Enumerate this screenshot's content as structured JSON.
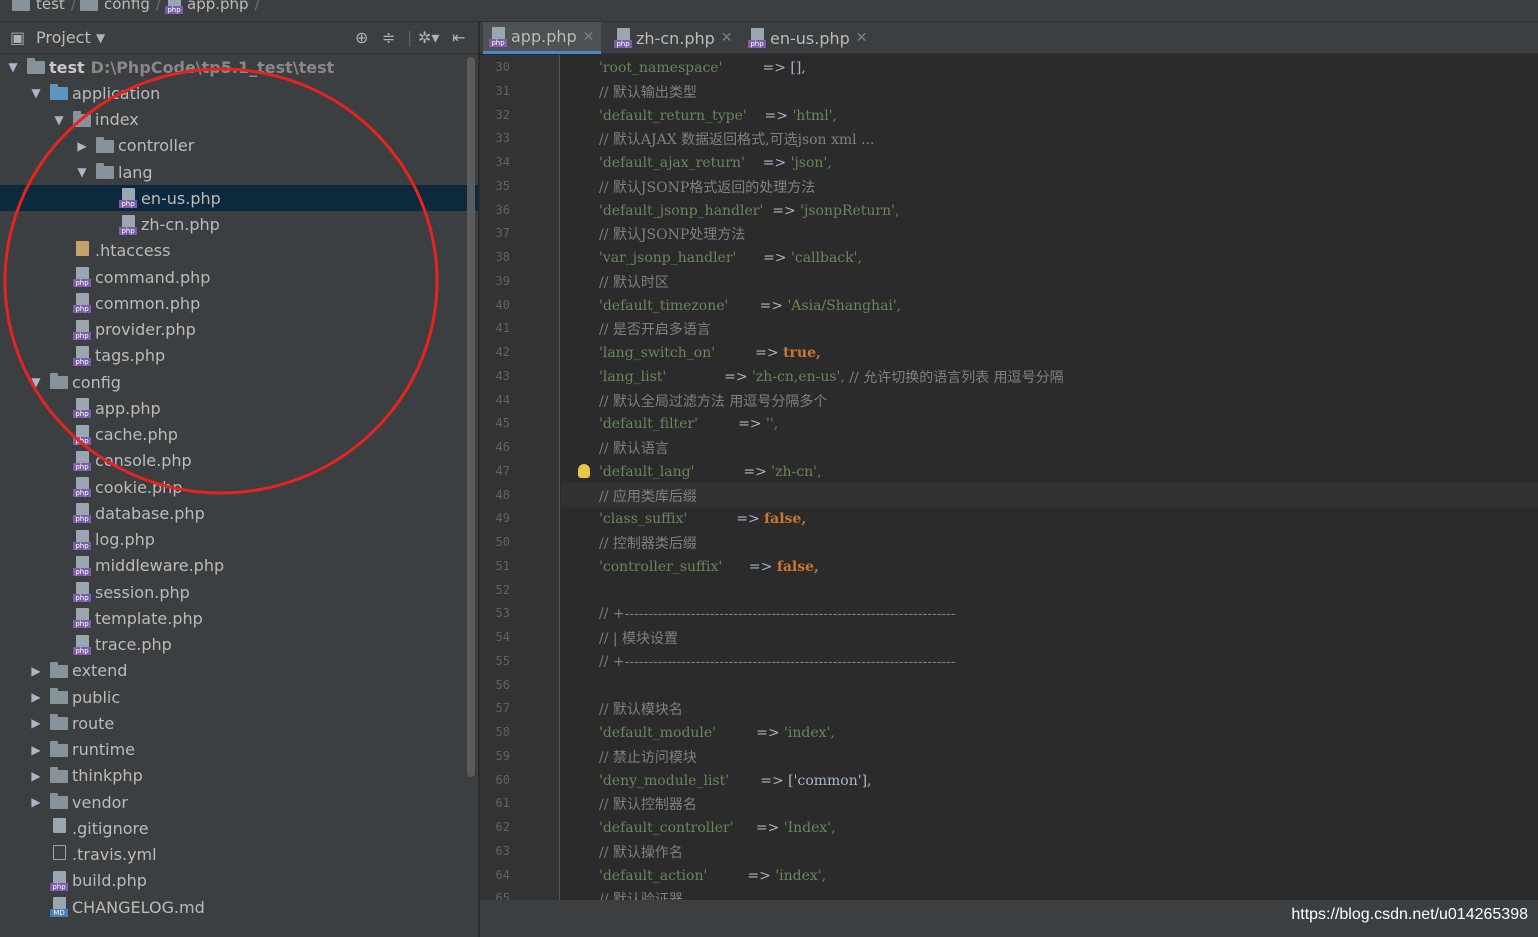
{
  "breadcrumb": [
    {
      "label": "test",
      "icon": "folder-icon"
    },
    {
      "label": "config",
      "icon": "folder-icon"
    },
    {
      "label": "app.php",
      "icon": "php-file-icon"
    }
  ],
  "project_panel": {
    "title": "Project",
    "tree": [
      {
        "label": "test",
        "path": "D:\\PhpCode\\tp5.1_test\\test",
        "type": "folder",
        "expanded": true
      },
      {
        "label": "application",
        "type": "folder-blue",
        "expanded": true
      },
      {
        "label": "index",
        "type": "folder",
        "expanded": true
      },
      {
        "label": "controller",
        "type": "folder",
        "expanded": false
      },
      {
        "label": "lang",
        "type": "folder",
        "expanded": true
      },
      {
        "label": "en-us.php",
        "type": "php",
        "selected": true
      },
      {
        "label": "zh-cn.php",
        "type": "php"
      },
      {
        "label": ".htaccess",
        "type": "htaccess"
      },
      {
        "label": "command.php",
        "type": "php"
      },
      {
        "label": "common.php",
        "type": "php"
      },
      {
        "label": "provider.php",
        "type": "php"
      },
      {
        "label": "tags.php",
        "type": "php"
      },
      {
        "label": "config",
        "type": "folder",
        "expanded": true
      },
      {
        "label": "app.php",
        "type": "php"
      },
      {
        "label": "cache.php",
        "type": "php"
      },
      {
        "label": "console.php",
        "type": "php"
      },
      {
        "label": "cookie.php",
        "type": "php"
      },
      {
        "label": "database.php",
        "type": "php"
      },
      {
        "label": "log.php",
        "type": "php"
      },
      {
        "label": "middleware.php",
        "type": "php"
      },
      {
        "label": "session.php",
        "type": "php"
      },
      {
        "label": "template.php",
        "type": "php"
      },
      {
        "label": "trace.php",
        "type": "php"
      },
      {
        "label": "extend",
        "type": "folder",
        "expanded": false
      },
      {
        "label": "public",
        "type": "folder",
        "expanded": false
      },
      {
        "label": "route",
        "type": "folder",
        "expanded": false
      },
      {
        "label": "runtime",
        "type": "folder",
        "expanded": false
      },
      {
        "label": "thinkphp",
        "type": "folder",
        "expanded": false
      },
      {
        "label": "vendor",
        "type": "folder",
        "expanded": false
      },
      {
        "label": ".gitignore",
        "type": "text"
      },
      {
        "label": ".travis.yml",
        "type": "yml"
      },
      {
        "label": "build.php",
        "type": "php"
      },
      {
        "label": "CHANGELOG.md",
        "type": "md"
      }
    ]
  },
  "tabs": [
    {
      "label": "app.php",
      "active": true
    },
    {
      "label": "zh-cn.php",
      "active": false
    },
    {
      "label": "en-us.php",
      "active": false
    }
  ],
  "editor": {
    "lines": [
      {
        "n": "30",
        "key": "'root_namespace'",
        "pad": "         ",
        "op": "=> ",
        "val": "[],",
        "vtype": "plain"
      },
      {
        "n": "31",
        "comment": "// 默认输出类型"
      },
      {
        "n": "32",
        "key": "'default_return_type'",
        "pad": "    ",
        "op": "=> ",
        "val": "'html',",
        "vtype": "str"
      },
      {
        "n": "33",
        "comment": "// 默认AJAX 数据返回格式,可选json xml ..."
      },
      {
        "n": "34",
        "key": "'default_ajax_return'",
        "pad": "    ",
        "op": "=> ",
        "val": "'json',",
        "vtype": "str"
      },
      {
        "n": "35",
        "comment": "// 默认JSONP格式返回的处理方法"
      },
      {
        "n": "36",
        "key": "'default_jsonp_handler'",
        "pad": "  ",
        "op": "=> ",
        "val": "'jsonpReturn',",
        "vtype": "str"
      },
      {
        "n": "37",
        "comment": "// 默认JSONP处理方法"
      },
      {
        "n": "38",
        "key": "'var_jsonp_handler'",
        "pad": "      ",
        "op": "=> ",
        "val": "'callback',",
        "vtype": "str"
      },
      {
        "n": "39",
        "comment": "// 默认时区"
      },
      {
        "n": "40",
        "key": "'default_timezone'",
        "pad": "       ",
        "op": "=> ",
        "val": "'Asia/Shanghai',",
        "vtype": "str"
      },
      {
        "n": "41",
        "comment": "// 是否开启多语言"
      },
      {
        "n": "42",
        "key": "'lang_switch_on'",
        "pad": "         ",
        "op": "=> ",
        "val": "true,",
        "vtype": "kw"
      },
      {
        "n": "43",
        "key": "'lang_list'",
        "pad": "             ",
        "op": "=> ",
        "val": "'zh-cn,en-us',",
        "vtype": "str",
        "trail": " // 允许切换的语言列表 用逗号分隔"
      },
      {
        "n": "44",
        "comment": "// 默认全局过滤方法 用逗号分隔多个"
      },
      {
        "n": "45",
        "key": "'default_filter'",
        "pad": "         ",
        "op": "=> ",
        "val": "'',",
        "vtype": "str"
      },
      {
        "n": "46",
        "comment": "// 默认语言"
      },
      {
        "n": "47",
        "key": "'default_lang'",
        "pad": "           ",
        "op": "=> ",
        "val": "'zh-cn',",
        "vtype": "str"
      },
      {
        "n": "48",
        "comment": "// 应用类库后缀"
      },
      {
        "n": "49",
        "key": "'class_suffix'",
        "pad": "           ",
        "op": "=> ",
        "val": "false,",
        "vtype": "kw"
      },
      {
        "n": "50",
        "comment": "// 控制器类后缀"
      },
      {
        "n": "51",
        "key": "'controller_suffix'",
        "pad": "      ",
        "op": "=> ",
        "val": "false,",
        "vtype": "kw"
      },
      {
        "n": "52"
      },
      {
        "n": "53",
        "comment": "// +----------------------------------------------------------------------"
      },
      {
        "n": "54",
        "comment": "// | 模块设置"
      },
      {
        "n": "55",
        "comment": "// +----------------------------------------------------------------------"
      },
      {
        "n": "56"
      },
      {
        "n": "57",
        "comment": "// 默认模块名"
      },
      {
        "n": "58",
        "key": "'default_module'",
        "pad": "         ",
        "op": "=> ",
        "val": "'index',",
        "vtype": "str"
      },
      {
        "n": "59",
        "comment": "// 禁止访问模块"
      },
      {
        "n": "60",
        "key": "'deny_module_list'",
        "pad": "       ",
        "op": "=> ",
        "val": "['common'],",
        "vtype": "mixed"
      },
      {
        "n": "61",
        "comment": "// 默认控制器名"
      },
      {
        "n": "62",
        "key": "'default_controller'",
        "pad": "     ",
        "op": "=> ",
        "val": "'Index',",
        "vtype": "str"
      },
      {
        "n": "63",
        "comment": "// 默认操作名"
      },
      {
        "n": "64",
        "key": "'default_action'",
        "pad": "         ",
        "op": "=> ",
        "val": "'index',",
        "vtype": "str"
      },
      {
        "n": "65",
        "comment": "// 默认验证器"
      }
    ]
  },
  "watermark": "https://blog.csdn.net/u014265398",
  "colors": {
    "annotation_circle": "#e8231f",
    "selection": "#0d293e",
    "string": "#6a8759",
    "keyword": "#cc7832",
    "comment": "#808080"
  }
}
